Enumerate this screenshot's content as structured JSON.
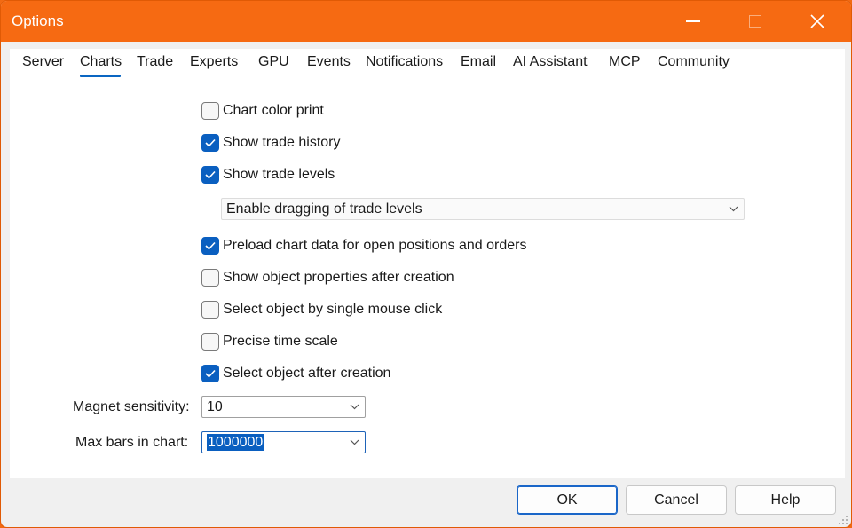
{
  "window": {
    "title": "Options",
    "accent_color": "#f66a12"
  },
  "tabs": [
    {
      "label": "Server"
    },
    {
      "label": "Charts",
      "active": true
    },
    {
      "label": "Trade"
    },
    {
      "label": "Experts"
    },
    {
      "label": "GPU"
    },
    {
      "label": "Events"
    },
    {
      "label": "Notifications"
    },
    {
      "label": "Email"
    },
    {
      "label": "AI Assistant"
    },
    {
      "label": "MCP"
    },
    {
      "label": "Community"
    }
  ],
  "options": {
    "chart_color_print": {
      "label": "Chart color print",
      "checked": false
    },
    "show_trade_history": {
      "label": "Show trade history",
      "checked": true
    },
    "show_trade_levels": {
      "label": "Show trade levels",
      "checked": true
    },
    "trade_levels_mode": {
      "value": "Enable dragging of trade levels"
    },
    "preload_chart_data": {
      "label": "Preload chart data for open positions and orders",
      "checked": true
    },
    "show_object_properties": {
      "label": "Show object properties after creation",
      "checked": false
    },
    "select_single_click": {
      "label": "Select object by single mouse click",
      "checked": false
    },
    "precise_time_scale": {
      "label": "Precise time scale",
      "checked": false
    },
    "select_after_creation": {
      "label": "Select object after creation",
      "checked": true
    }
  },
  "fields": {
    "magnet_sensitivity": {
      "label": "Magnet sensitivity:",
      "value": "10"
    },
    "max_bars": {
      "label": "Max bars in chart:",
      "value": "1000000"
    }
  },
  "buttons": {
    "ok": "OK",
    "cancel": "Cancel",
    "help": "Help"
  },
  "icons": {
    "checkmark": "checkmark-icon",
    "dropdown": "chevron-down-icon",
    "close": "close-icon",
    "minimize": "minimize-icon",
    "maximize": "maximize-icon"
  }
}
